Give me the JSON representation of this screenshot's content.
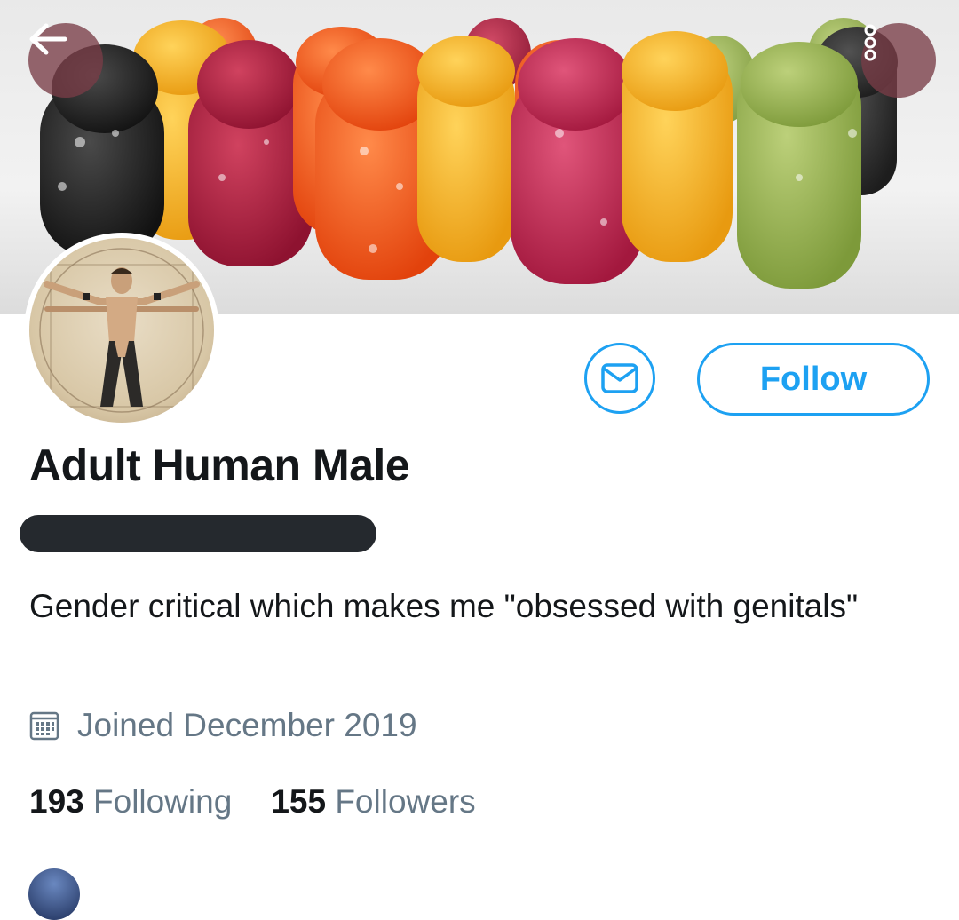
{
  "header": {
    "back_icon": "arrow-left-icon",
    "more_icon": "more-options-icon"
  },
  "profile": {
    "display_name": "Adult Human Male",
    "bio": "Gender critical which makes me \"obsessed with genitals\"",
    "joined": "Joined December 2019",
    "following_count": "193",
    "following_label": "Following",
    "followers_count": "155",
    "followers_label": "Followers"
  },
  "actions": {
    "message_icon": "envelope-icon",
    "follow_label": "Follow"
  },
  "colors": {
    "accent": "#1da1f2",
    "muted_text": "#657786",
    "primary_text": "#14171a"
  }
}
